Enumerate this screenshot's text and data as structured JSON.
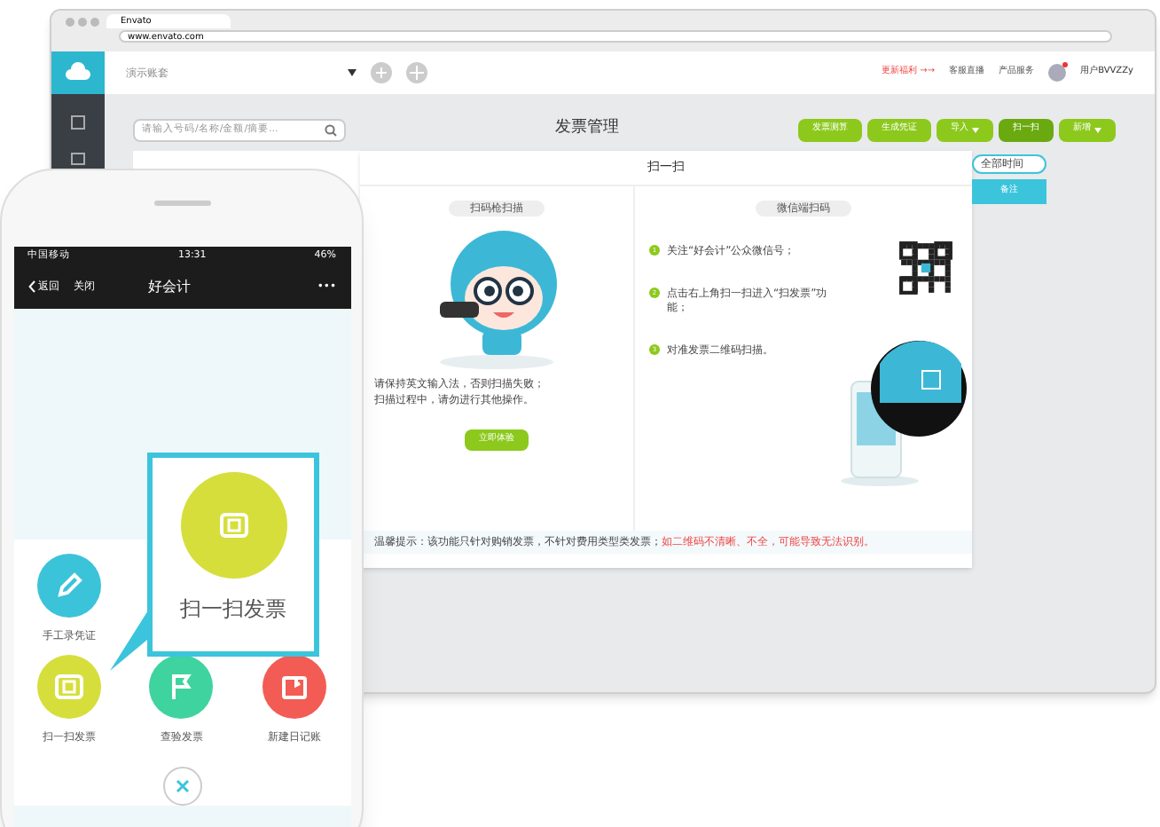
{
  "browser": {
    "tab": "Envato",
    "url": "www.envato.com"
  },
  "topbar": {
    "account_set": "演示账套",
    "links": [
      {
        "label": "更新福利 →→",
        "kind": "alert"
      },
      {
        "label": "客服直播",
        "kind": "live"
      },
      {
        "label": "产品服务",
        "kind": "help"
      }
    ],
    "user": "用户BVVZZy"
  },
  "toolbar": {
    "search": {
      "placeholder": "请输入号码/名称/金额/摘要..."
    },
    "title": "发票管理",
    "buttons": [
      {
        "label": "发票测算",
        "dropdown": false,
        "selected": false
      },
      {
        "label": "生成凭证",
        "dropdown": false,
        "selected": false
      },
      {
        "label": "导入",
        "dropdown": true,
        "selected": false
      },
      {
        "label": "扫一扫",
        "dropdown": false,
        "selected": true
      },
      {
        "label": "新增",
        "dropdown": true,
        "selected": false
      }
    ]
  },
  "side_controls": {
    "filter": "全部时间",
    "button": "备注"
  },
  "scan_dialog": {
    "title": "扫一扫",
    "scanner": {
      "heading": "扫码枪扫描",
      "note": [
        "请保持英文输入法，否则扫描失败；",
        "扫描过程中，请勿进行其他操作。"
      ],
      "button": "立即体验"
    },
    "wechat": {
      "heading": "微信端扫码",
      "steps": [
        {
          "number": "1",
          "text": "关注“好会计”公众微信号；"
        },
        {
          "number": "2",
          "text": "点击右上角扫一扫进入“扫发票”功能；"
        },
        {
          "number": "3",
          "text": "对准发票二维码扫描。"
        }
      ]
    },
    "tip": "温馨提示：该功能只针对购销发票，不针对费用类型类发票；",
    "warning": "如二维码不清晰、不全，可能导致无法识别。"
  },
  "phone": {
    "status": {
      "carrier": "中国移动",
      "time": "13:31",
      "battery": "46%"
    },
    "nav": {
      "back": "返回",
      "close": "关闭",
      "title": "好会计",
      "more": "•••"
    },
    "action_rows": [
      [
        {
          "label": "手工录凭证",
          "color": "#3bc3d9",
          "kind": "pencil"
        }
      ],
      [
        {
          "label": "扫一扫发票",
          "color": "#d6de3c",
          "kind": "ticket"
        },
        {
          "label": "查验发票",
          "color": "#3fd3a0",
          "kind": "flag"
        },
        {
          "label": "新建日记账",
          "color": "#f25c54",
          "kind": "calendar"
        }
      ]
    ],
    "callout": {
      "label": "扫一扫发票"
    }
  }
}
